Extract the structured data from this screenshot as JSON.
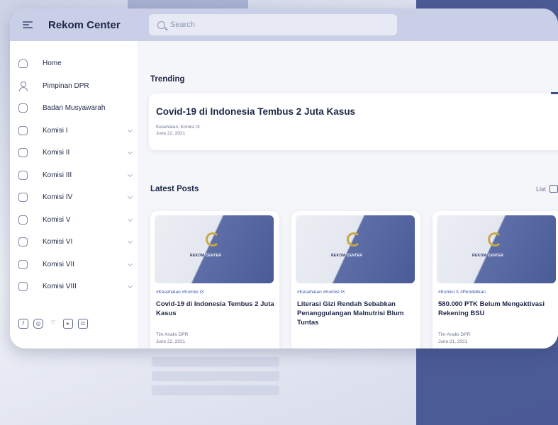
{
  "brand": "Rekom Center",
  "search": {
    "placeholder": "Search"
  },
  "sidebar": {
    "items": [
      {
        "label": "Home"
      },
      {
        "label": "Pimpinan DPR"
      },
      {
        "label": "Badan Musyawarah"
      },
      {
        "label": "Komisi I"
      },
      {
        "label": "Komisi II"
      },
      {
        "label": "Komisi III"
      },
      {
        "label": "Komisi IV"
      },
      {
        "label": "Komisi V"
      },
      {
        "label": "Komisi VI"
      },
      {
        "label": "Komisi VII"
      },
      {
        "label": "Komisi VIII"
      }
    ],
    "socials": [
      "facebook-icon",
      "instagram-icon",
      "twitter-icon",
      "youtube-icon",
      "website-icon"
    ]
  },
  "trending": {
    "heading": "Trending",
    "title": "Covid-19 di Indonesia Tembus 2 Juta Kasus",
    "tags": "Kesehatan, Komisi IX",
    "date": "June 22, 2021"
  },
  "latest": {
    "heading": "Latest Posts",
    "view_label": "List",
    "posts": [
      {
        "thumb_text_a": "REKOM",
        "thumb_text_b": "CENTER",
        "tags": "#Kesehatan  #Komisi IX",
        "title": "Covid-19 di Indonesia Tembus 2 Juta Kasus",
        "author": "Tim Analis DPR",
        "date": "June 22, 2021"
      },
      {
        "thumb_text_a": "REKOM",
        "thumb_text_b": "CENTER",
        "tags": "#Kesehatan  #Komisi IX",
        "title": "Literasi Gizi Rendah Sebabkan Penanggulangan Malnutrisi Blum Tuntas",
        "author": "",
        "date": ""
      },
      {
        "thumb_text_a": "REKOM",
        "thumb_text_b": "CENTER",
        "tags": "#Komisi X  #Pendidikan",
        "title": "580.000 PTK Belum Mengaktivasi Rekening BSU",
        "author": "Tim Analis DPR",
        "date": "June 21, 2021"
      }
    ]
  },
  "colors": {
    "accent": "#3f4f8e",
    "tag": "#3f55b3",
    "topbar": "#c9cfe6"
  }
}
